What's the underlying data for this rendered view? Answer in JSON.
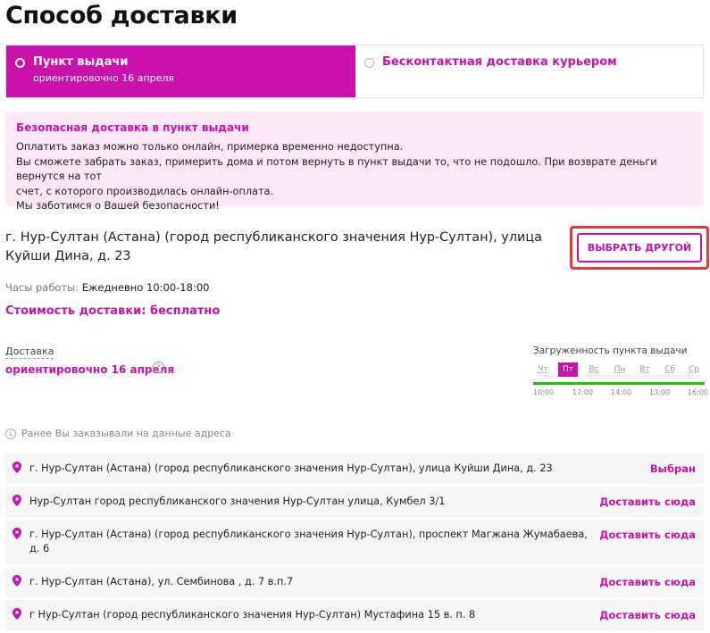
{
  "page": {
    "title": "Способ доставки"
  },
  "tabs": [
    {
      "label": "Пункт выдачи",
      "sub": "ориентировочно 16 апреля",
      "active": true
    },
    {
      "label": "Бесконтактная доставка курьером",
      "active": false
    }
  ],
  "notice": {
    "title": "Безопасная доставка в пункт выдачи",
    "lines": [
      "Оплатить заказ можно только онлайн, примерка временно недоступна.",
      "Вы сможете забрать заказ, примерить дома и потом вернуть в пункт выдачи то, что не подошло. При возврате деньги вернутся на тот",
      "счет, с которого производилась онлайн-оплата.",
      "Мы заботимся о Вашей безопасности!"
    ]
  },
  "pickup": {
    "address": "г. Нур-Султан (Астана) (город республиканского значения Нур-Султан), улица Куйши Дина, д. 23",
    "change_label": "ВЫБРАТЬ ДРУГОЙ",
    "hours_label": "Часы работы:",
    "hours_value": "Ежедневно 10:00-18:00",
    "cost": "Стоимость доставки: бесплатно"
  },
  "delivery": {
    "label": "Доставка",
    "date": "ориентировочно 16 апреля",
    "help_icon": "question-circle-icon"
  },
  "load": {
    "title": "Загруженность пункта выдачи",
    "days": [
      "Чт",
      "Пт",
      "Вс",
      "Пн",
      "Вт",
      "Сб",
      "Ср"
    ],
    "active_day": "Пт",
    "times": [
      "10:00",
      "17:00",
      "14:00",
      "13:00",
      "16:00"
    ],
    "bar_color": "#20c400"
  },
  "history": {
    "title": "Ранее Вы заказывали на данные адреса",
    "icon": "history-icon",
    "items": [
      {
        "address": "г. Нур-Султан (Астана) (город республиканского значения Нур-Султан), улица Куйши Дина, д. 23",
        "action": "Выбран",
        "selected": true
      },
      {
        "address": "Нур-Султан город республиканского значения Нур-Султан улица, Кумбел 3/1",
        "action": "Доставить сюда",
        "selected": false
      },
      {
        "address": "г. Нур-Султан (Астана) (город республиканского значения Нур-Султан), проспект Магжана Жумабаева, д. 6",
        "action": "Доставить сюда",
        "selected": false
      },
      {
        "address": "г. Нур-Султан (Астана), ул. Сембинова , д. 7 в.п.7",
        "action": "Доставить сюда",
        "selected": false
      },
      {
        "address": "г Нур-Султан (город республиканского значения Нур-Султан) Мустафина 15 в. п. 8",
        "action": "Доставить сюда",
        "selected": false
      }
    ]
  },
  "colors": {
    "accent": "#cb11ab",
    "notice_bg": "#fce8f6",
    "highlight": "#e53935"
  }
}
